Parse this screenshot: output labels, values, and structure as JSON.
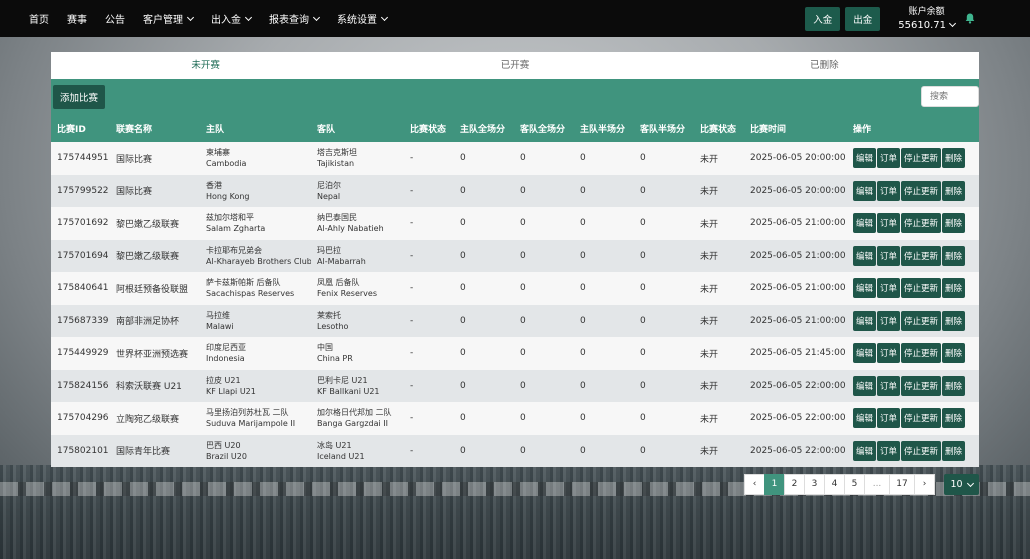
{
  "nav": {
    "items": [
      {
        "label": "首页",
        "dropdown": false
      },
      {
        "label": "赛事",
        "dropdown": false
      },
      {
        "label": "公告",
        "dropdown": false
      },
      {
        "label": "客户管理",
        "dropdown": true
      },
      {
        "label": "出入金",
        "dropdown": true
      },
      {
        "label": "报表查询",
        "dropdown": true
      },
      {
        "label": "系统设置",
        "dropdown": true
      }
    ],
    "deposit_label": "入金",
    "withdraw_label": "出金",
    "balance_label": "账户余额",
    "balance_value": "55610.71",
    "bell_icon": "bell-icon"
  },
  "tabs": [
    "未开赛",
    "已开赛",
    "已删除"
  ],
  "active_tab": 0,
  "toolbar": {
    "add_label": "添加比赛",
    "search_placeholder": "搜索"
  },
  "table": {
    "headers": [
      "比赛ID",
      "联赛名称",
      "主队",
      "客队",
      "比赛状态",
      "主队全场分",
      "客队全场分",
      "主队半场分",
      "客队半场分",
      "比赛状态",
      "比赛时间",
      "操作"
    ],
    "actions": [
      "编辑",
      "订单",
      "停止更新",
      "删除"
    ],
    "rows": [
      {
        "id": "175744951",
        "league": "国际比赛",
        "home_cn": "柬埔寨",
        "home_en": "Cambodia",
        "away_cn": "塔吉克斯坦",
        "away_en": "Tajikistan",
        "status1": "-",
        "hf": "0",
        "af": "0",
        "hh": "0",
        "ah": "0",
        "status2": "未开",
        "time": "2025-06-05 20:00:00"
      },
      {
        "id": "175799522",
        "league": "国际比赛",
        "home_cn": "香港",
        "home_en": "Hong Kong",
        "away_cn": "尼泊尔",
        "away_en": "Nepal",
        "status1": "-",
        "hf": "0",
        "af": "0",
        "hh": "0",
        "ah": "0",
        "status2": "未开",
        "time": "2025-06-05 20:00:00"
      },
      {
        "id": "175701692",
        "league": "黎巴嫩乙级联赛",
        "home_cn": "兹加尔塔和平",
        "home_en": "Salam Zgharta",
        "away_cn": "纳巴泰国民",
        "away_en": "Al-Ahly Nabatieh",
        "status1": "-",
        "hf": "0",
        "af": "0",
        "hh": "0",
        "ah": "0",
        "status2": "未开",
        "time": "2025-06-05 21:00:00"
      },
      {
        "id": "175701694",
        "league": "黎巴嫩乙级联赛",
        "home_cn": "卡拉耶布兄弟会",
        "home_en": "Al-Kharayeb Brothers Club",
        "away_cn": "玛巴拉",
        "away_en": "Al-Mabarrah",
        "status1": "-",
        "hf": "0",
        "af": "0",
        "hh": "0",
        "ah": "0",
        "status2": "未开",
        "time": "2025-06-05 21:00:00"
      },
      {
        "id": "175840641",
        "league": "阿根廷预备役联盟",
        "home_cn": "萨卡兹斯帕斯 后备队",
        "home_en": "Sacachispas Reserves",
        "away_cn": "凤凰 后备队",
        "away_en": "Fenix Reserves",
        "status1": "-",
        "hf": "0",
        "af": "0",
        "hh": "0",
        "ah": "0",
        "status2": "未开",
        "time": "2025-06-05 21:00:00"
      },
      {
        "id": "175687339",
        "league": "南部非洲足协杯",
        "home_cn": "马拉维",
        "home_en": "Malawi",
        "away_cn": "莱索托",
        "away_en": "Lesotho",
        "status1": "-",
        "hf": "0",
        "af": "0",
        "hh": "0",
        "ah": "0",
        "status2": "未开",
        "time": "2025-06-05 21:00:00"
      },
      {
        "id": "175449929",
        "league": "世界杯亚洲预选赛",
        "home_cn": "印度尼西亚",
        "home_en": "Indonesia",
        "away_cn": "中国",
        "away_en": "China PR",
        "status1": "-",
        "hf": "0",
        "af": "0",
        "hh": "0",
        "ah": "0",
        "status2": "未开",
        "time": "2025-06-05 21:45:00"
      },
      {
        "id": "175824156",
        "league": "科索沃联赛 U21",
        "home_cn": "拉皮 U21",
        "home_en": "KF Llapi U21",
        "away_cn": "巴利卡尼 U21",
        "away_en": "KF Ballkani U21",
        "status1": "-",
        "hf": "0",
        "af": "0",
        "hh": "0",
        "ah": "0",
        "status2": "未开",
        "time": "2025-06-05 22:00:00"
      },
      {
        "id": "175704296",
        "league": "立陶宛乙级联赛",
        "home_cn": "马里扬泊列苏杜瓦 二队",
        "home_en": "Suduva Marijampole II",
        "away_cn": "加尔格日代邦加 二队",
        "away_en": "Banga Gargzdai II",
        "status1": "-",
        "hf": "0",
        "af": "0",
        "hh": "0",
        "ah": "0",
        "status2": "未开",
        "time": "2025-06-05 22:00:00"
      },
      {
        "id": "175802101",
        "league": "国际青年比赛",
        "home_cn": "巴西 U20",
        "home_en": "Brazil U20",
        "away_cn": "冰岛 U21",
        "away_en": "Iceland U21",
        "status1": "-",
        "hf": "0",
        "af": "0",
        "hh": "0",
        "ah": "0",
        "status2": "未开",
        "time": "2025-06-05 22:00:00"
      }
    ]
  },
  "pagination": {
    "prev": "‹",
    "next": "›",
    "pages": [
      "1",
      "2",
      "3",
      "4",
      "5",
      "...",
      "17"
    ],
    "current": "1",
    "page_size": "10"
  }
}
